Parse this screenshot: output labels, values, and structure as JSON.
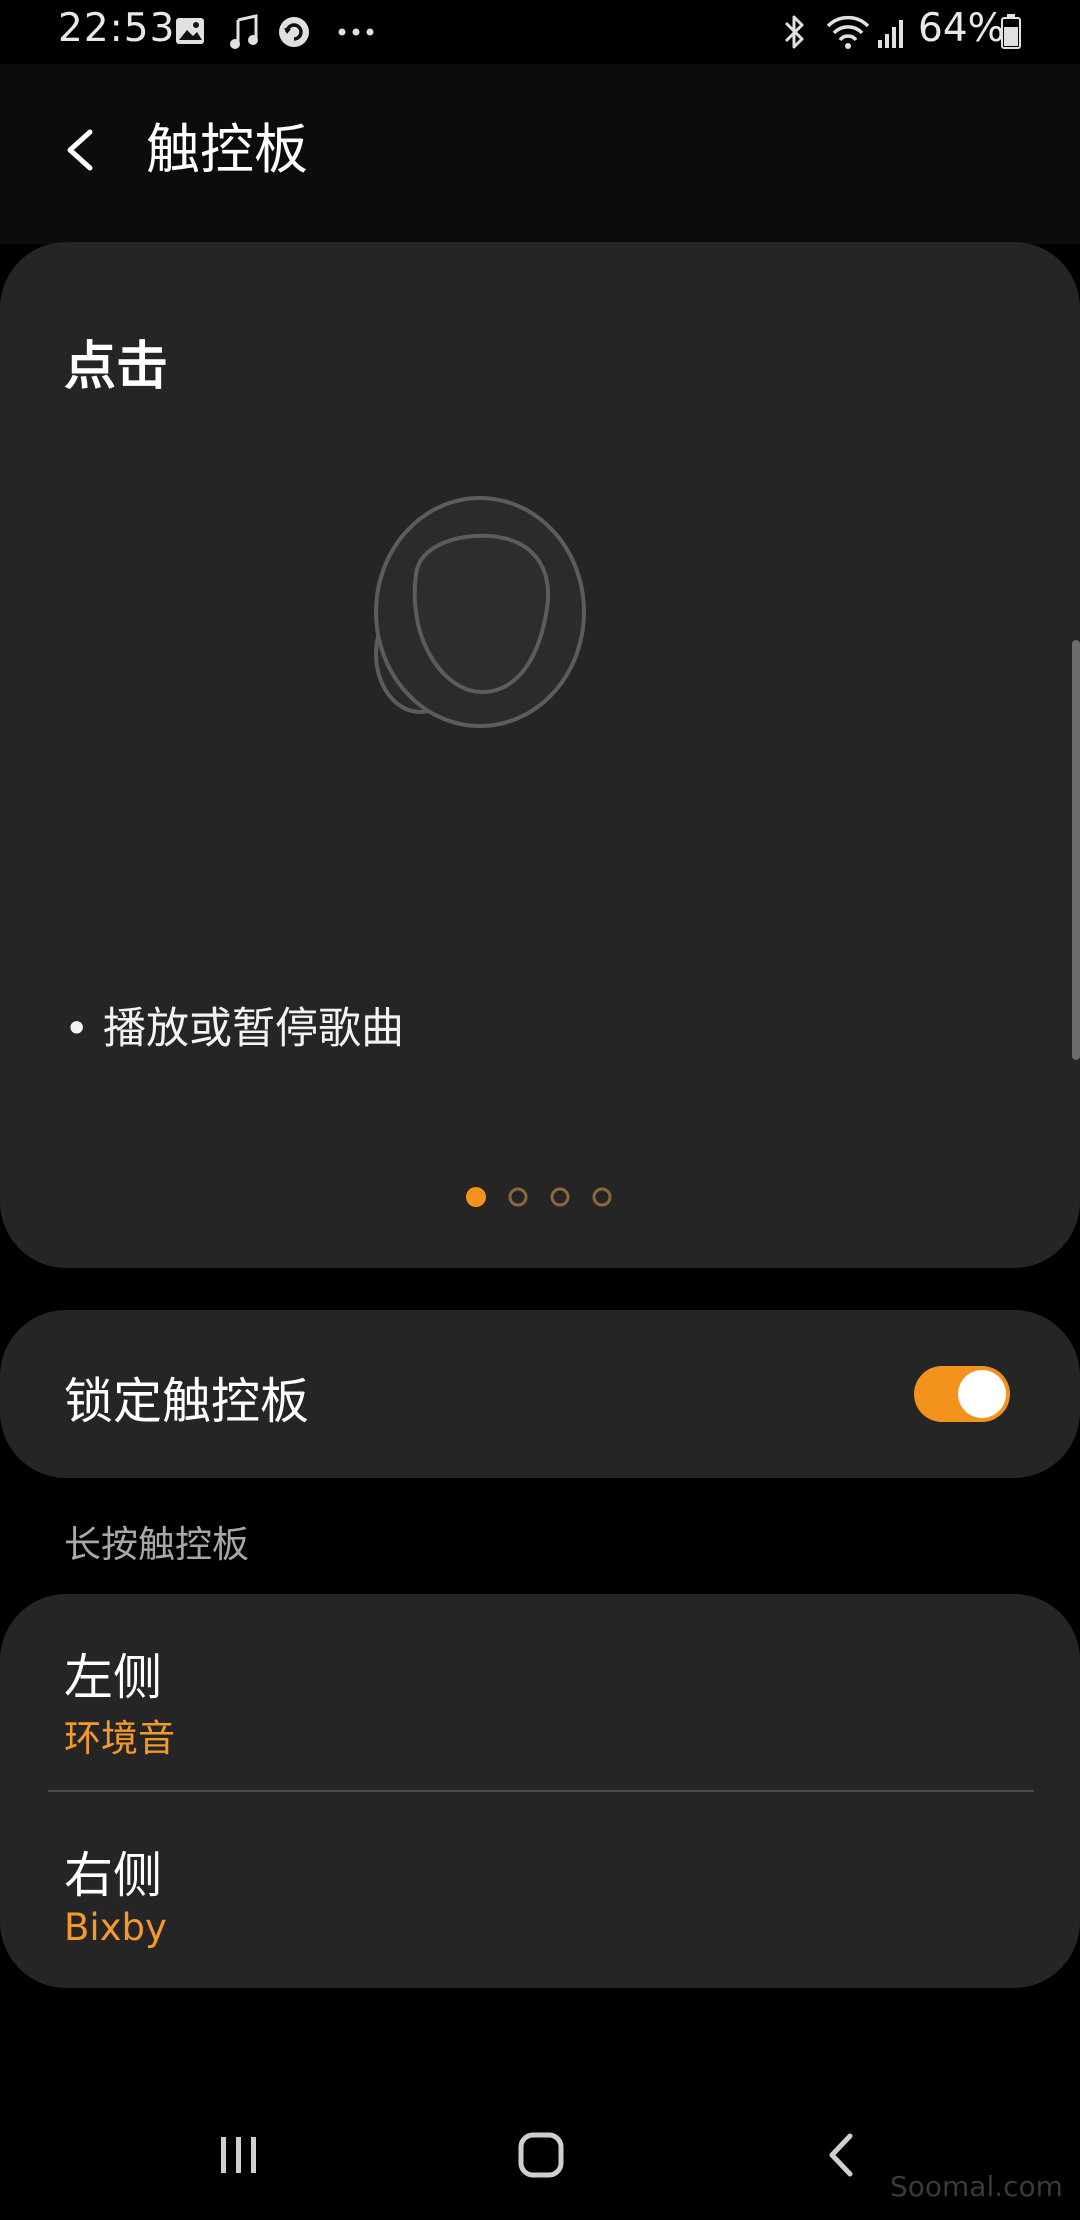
{
  "status_bar": {
    "time": "22:53",
    "left_icons": [
      "gallery-icon",
      "music-icon",
      "sync-icon",
      "more-dots-icon"
    ],
    "right_icons": [
      "bluetooth-icon",
      "wifi-icon",
      "signal-icon",
      "battery-icon"
    ],
    "battery": "64%"
  },
  "header": {
    "title": "触控板",
    "back_icon": "back-arrow-icon"
  },
  "tap_card": {
    "title": "点击",
    "illustration": "earbud-icon",
    "description": "• 播放或暂停歌曲",
    "pager": {
      "count": 4,
      "active": 0
    }
  },
  "lock_card": {
    "label": "锁定触控板",
    "enabled": true
  },
  "long_press": {
    "section_label": "长按触控板",
    "rows": [
      {
        "title": "左侧",
        "value": "环境音"
      },
      {
        "title": "右侧",
        "value": "Bixby"
      }
    ]
  },
  "nav_bar": {
    "icons": [
      "recents-icon",
      "home-icon",
      "back-icon"
    ],
    "watermark": "Soomal.com"
  },
  "colors": {
    "accent": "#f3921d",
    "card_bg": "#252525",
    "page_bg": "#000000"
  }
}
